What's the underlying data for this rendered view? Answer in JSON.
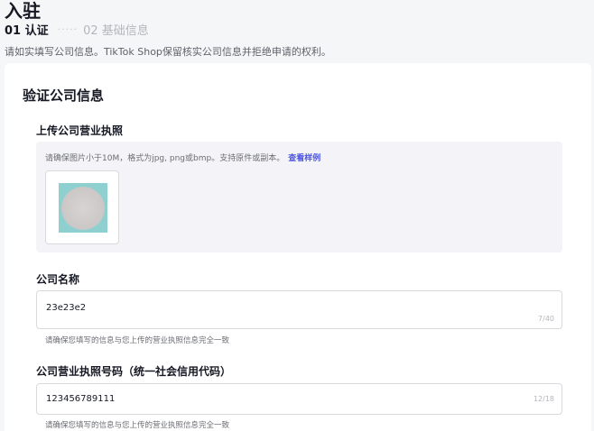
{
  "page": {
    "title": "入驻",
    "steps": [
      {
        "label": "01 认证",
        "state": "active"
      },
      {
        "label": "02 基础信息",
        "state": "inactive"
      }
    ],
    "step_divider": "·····",
    "description": "请如实填写公司信息。TikTok Shop保留核实公司信息并拒绝申请的权利。"
  },
  "form": {
    "section_title": "验证公司信息",
    "license_upload": {
      "label": "上传公司营业执照",
      "hint": "请确保图片小于10M，格式为jpg, png或bmp。支持原件或副本。",
      "sample_link": "查看样例"
    },
    "company_name": {
      "label": "公司名称",
      "value": "23e23e2",
      "counter": "7/40",
      "help": "请确保您填写的信息与您上传的营业执照信息完全一致"
    },
    "license_number": {
      "label": "公司营业执照号码（统一社会信用代码）",
      "value": "123456789111",
      "counter": "12/18",
      "help": "请确保您填写的信息与您上传的营业执照信息完全一致"
    }
  },
  "colors": {
    "background": "#f5f6f7",
    "card": "#ffffff",
    "link": "#4c56e3",
    "upload_area": "#f4f4f8"
  }
}
